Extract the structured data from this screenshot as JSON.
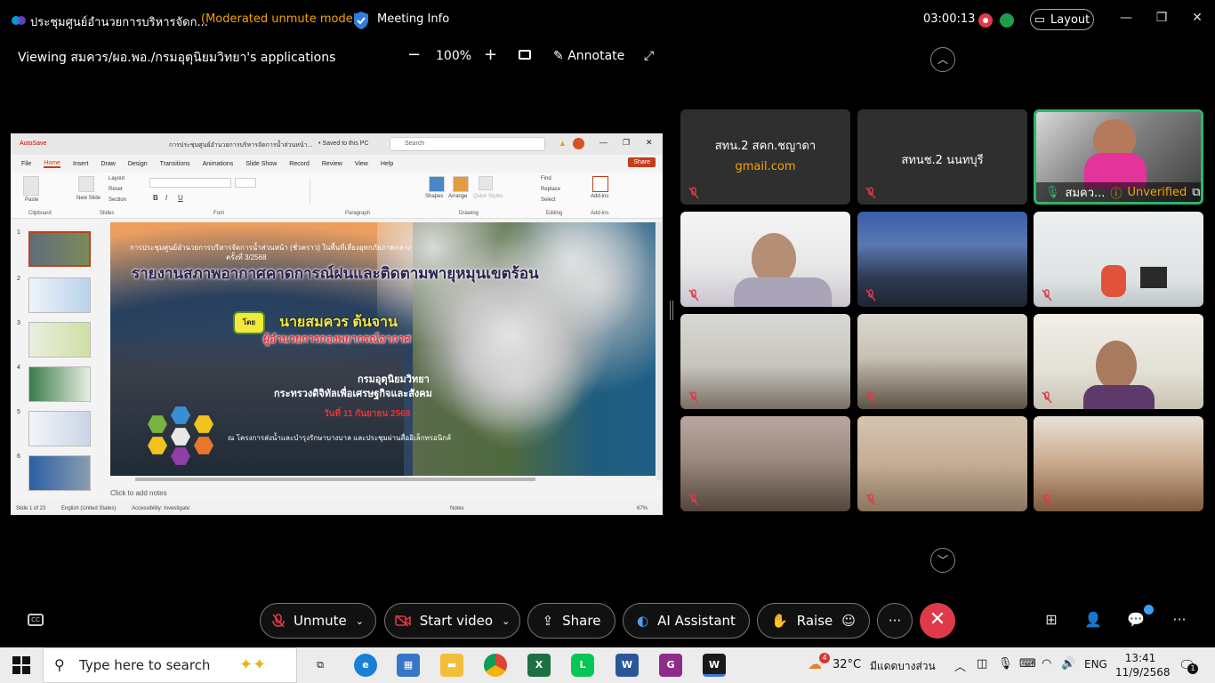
{
  "titlebar": {
    "meeting_title": "ประชุมศูนย์อำนวยการบริหารจัดก...",
    "mode": "(Moderated unmute mode)",
    "meeting_info": "Meeting Info",
    "timer": "03:00:13",
    "layout_label": "Layout"
  },
  "sharebar": {
    "viewing": "Viewing สมควร/ผอ.พอ./กรมอุตุนิยมวิทยา's applications",
    "zoom": "100%",
    "annotate": "Annotate"
  },
  "ppt": {
    "autosave": "AutoSave",
    "filename": "การประชุมศูนย์อำนวยการบริหารจัดการน้ำส่วนหน้า...",
    "saved": "• Saved to this PC",
    "search_placeholder": "Search",
    "menu": [
      "File",
      "Home",
      "Insert",
      "Draw",
      "Design",
      "Transitions",
      "Animations",
      "Slide Show",
      "Record",
      "Review",
      "View",
      "Help"
    ],
    "share": "Share",
    "groups": [
      "Clipboard",
      "Slides",
      "Font",
      "Paragraph",
      "Drawing",
      "Editing",
      "Add-ins"
    ],
    "ribbon_labels": {
      "paste": "Paste",
      "new_slide": "New Slide",
      "layout": "Layout",
      "reset": "Reset",
      "section": "Section",
      "shapes": "Shapes",
      "arrange": "Arrange",
      "quick_styles": "Quick Styles",
      "find": "Find",
      "replace": "Replace",
      "select": "Select",
      "add_ins": "Add-ins"
    },
    "thumb_numbers": [
      "1",
      "2",
      "3",
      "4",
      "5",
      "6"
    ],
    "notes_placeholder": "Click to add notes",
    "status_slide": "Slide 1 of 23",
    "status_lang": "English (United States)",
    "status_access": "Accessibility: Investigate",
    "status_notes": "Notes",
    "status_zoom": "67%",
    "slide": {
      "sub1": "การประชุมศูนย์อำนวยการบริหารจัดการน้ำส่วนหน้า (ชั่วคราว) ในพื้นที่เสี่ยงอุทกภัยภาคกลาง",
      "sub2": "ครั้งที่ 3/2568",
      "title": "รายงานสภาพอากาศคาดการณ์ฝนและติดตามพายุหมุนเขตร้อน",
      "by": "โดย",
      "name": "นายสมควร   ต้นจาน",
      "position": "ผู้อำนวยการกองพยากรณ์อากาศ",
      "dept": "กรมอุตุนิยมวิทยา",
      "ministry": "กระทรวงดิจิทัลเพื่อเศรษฐกิจและสังคม",
      "date": "วันที่ 11 กันยายน 2568",
      "place": "ณ โครงการส่งน้ำและบำรุงรักษาบางบาล และประชุมผ่านสื่ออิเล็กทรอนิกส์"
    }
  },
  "tiles": [
    {
      "name": "สทน.2 สคก.ชญาดา",
      "sub": "gmail.com"
    },
    {
      "name": "สทนช.2 นนทบุรี",
      "sub": ""
    },
    {
      "name": "สมคว...",
      "sub": "Unverified"
    }
  ],
  "toolbar": {
    "unmute": "Unmute",
    "start_video": "Start video",
    "share": "Share",
    "ai_assistant": "AI Assistant",
    "raise": "Raise"
  },
  "taskbar": {
    "search_placeholder": "Type here to search",
    "temperature": "32°C",
    "weather": "มีแดดบางส่วน",
    "weather_badge": "4",
    "lang": "ENG",
    "time": "13:41",
    "date": "11/9/2568",
    "notifications": "1"
  },
  "colors": {
    "accent_orange": "#f4a300",
    "leave_red": "#e0394a",
    "active_green": "#2fb56a",
    "ppt_red": "#c43e1c"
  }
}
